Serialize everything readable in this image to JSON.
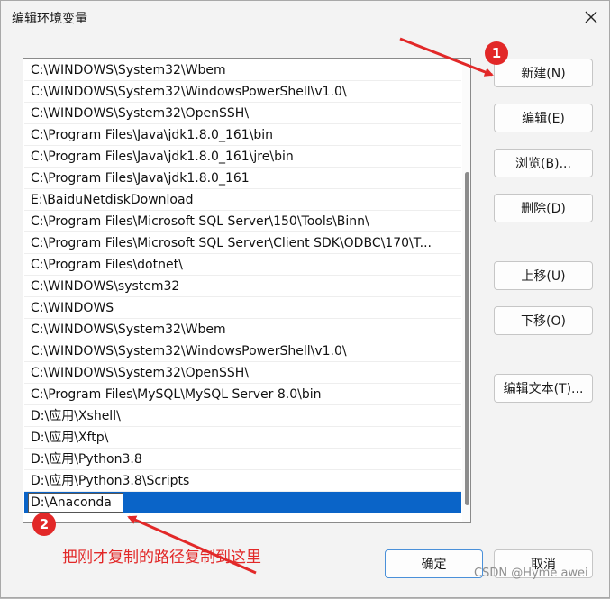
{
  "dialog": {
    "title": "编辑环境变量",
    "close_label": "✕"
  },
  "path_list": {
    "items": [
      "C:\\WINDOWS\\System32\\Wbem",
      "C:\\WINDOWS\\System32\\WindowsPowerShell\\v1.0\\",
      "C:\\WINDOWS\\System32\\OpenSSH\\",
      "C:\\Program Files\\Java\\jdk1.8.0_161\\bin",
      "C:\\Program Files\\Java\\jdk1.8.0_161\\jre\\bin",
      "C:\\Program Files\\Java\\jdk1.8.0_161",
      "E:\\BaiduNetdiskDownload",
      "C:\\Program Files\\Microsoft SQL Server\\150\\Tools\\Binn\\",
      "C:\\Program Files\\Microsoft SQL Server\\Client SDK\\ODBC\\170\\T...",
      "C:\\Program Files\\dotnet\\",
      "C:\\WINDOWS\\system32",
      "C:\\WINDOWS",
      "C:\\WINDOWS\\System32\\Wbem",
      "C:\\WINDOWS\\System32\\WindowsPowerShell\\v1.0\\",
      "C:\\WINDOWS\\System32\\OpenSSH\\",
      "C:\\Program Files\\MySQL\\MySQL Server 8.0\\bin",
      "D:\\应用\\Xshell\\",
      "D:\\应用\\Xftp\\",
      "D:\\应用\\Python3.8",
      "D:\\应用\\Python3.8\\Scripts"
    ],
    "editing_value": "D:\\Anaconda"
  },
  "buttons": {
    "new": "新建(N)",
    "edit": "编辑(E)",
    "browse": "浏览(B)...",
    "delete": "删除(D)",
    "move_up": "上移(U)",
    "move_down": "下移(O)",
    "edit_text": "编辑文本(T)...",
    "ok": "确定",
    "cancel": "取消"
  },
  "annotations": {
    "badge_1": "1",
    "badge_2": "2",
    "note": "把刚才复制的路径复制到这里",
    "watermark": "CSDN @Hyme awei",
    "color": "#e22828"
  }
}
